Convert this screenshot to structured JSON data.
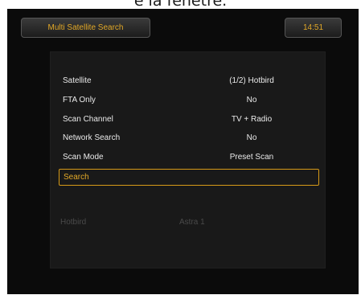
{
  "caption": "e la fenêtre.",
  "header": {
    "title": "Multi Satellite Search",
    "clock": "14:51"
  },
  "settings": [
    {
      "label": "Satellite",
      "value": "(1/2) Hotbird"
    },
    {
      "label": "FTA Only",
      "value": "No"
    },
    {
      "label": "Scan Channel",
      "value": "TV + Radio"
    },
    {
      "label": "Network Search",
      "value": "No"
    },
    {
      "label": "Scan Mode",
      "value": "Preset Scan"
    }
  ],
  "action": {
    "label": "Search"
  },
  "satellites": [
    "Hotbird",
    "Astra 1"
  ],
  "colors": {
    "accent": "#e3a928",
    "background": "#0b0b0b",
    "panel": "#191919"
  }
}
